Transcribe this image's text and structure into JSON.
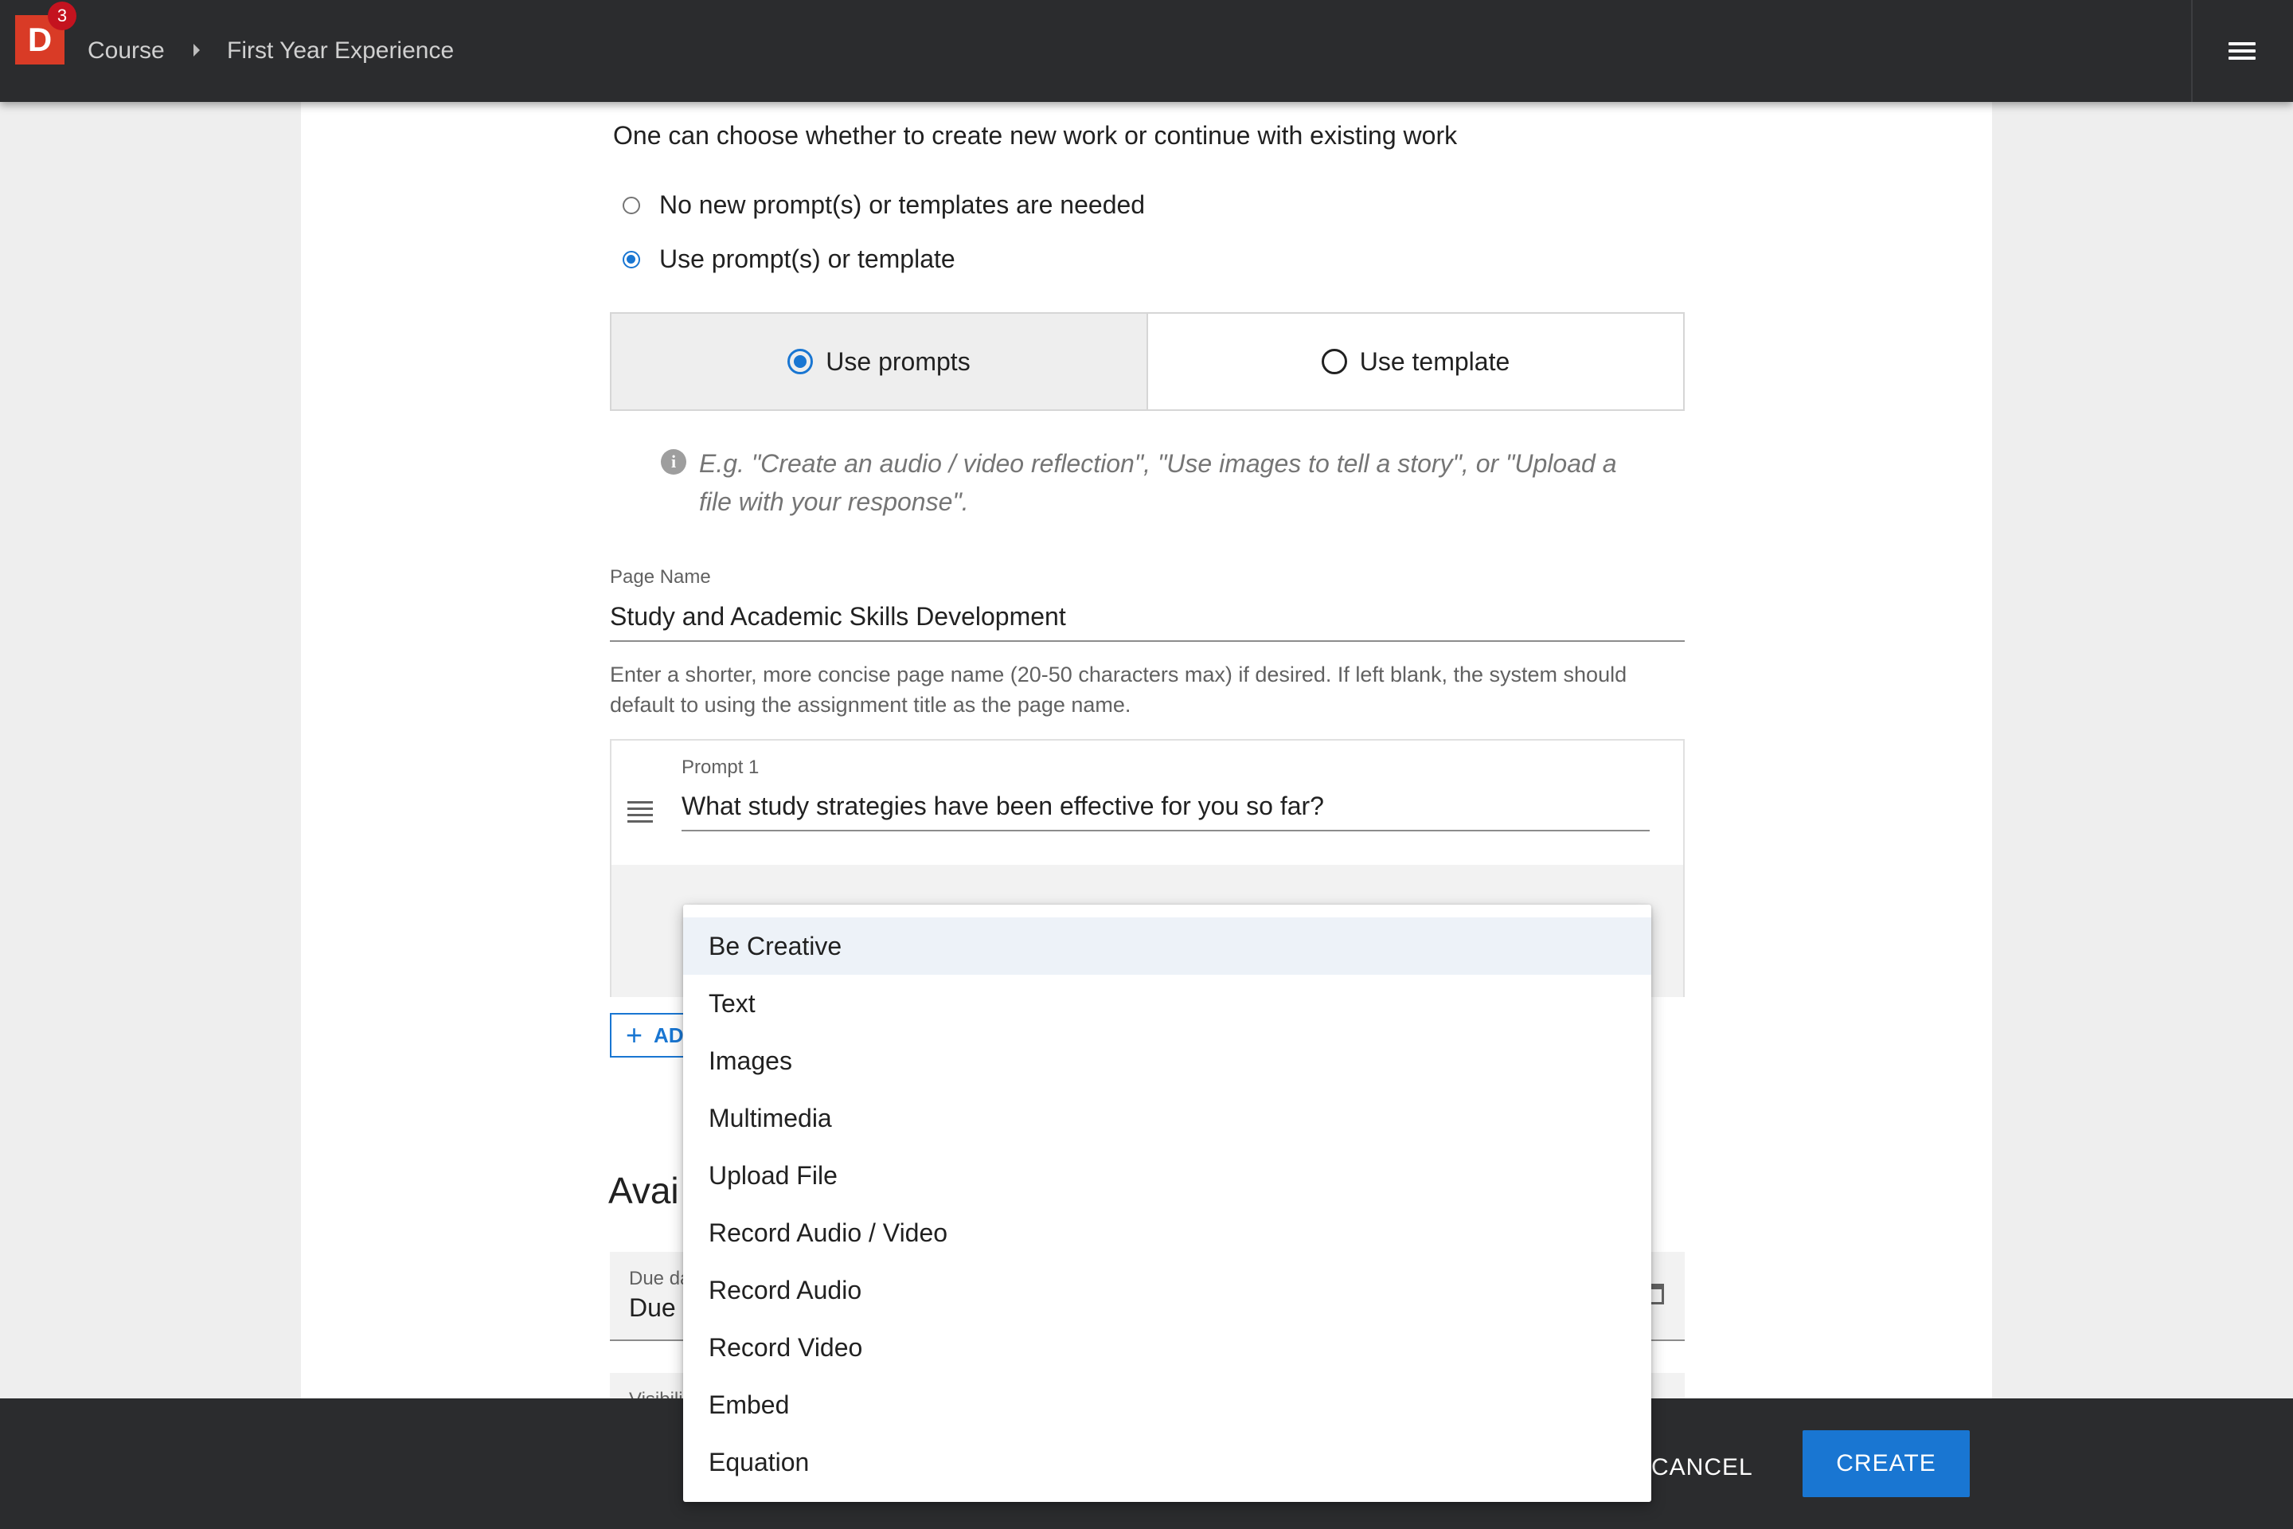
{
  "topbar": {
    "logo_letter": "D",
    "badge_count": "3",
    "breadcrumb": [
      "Course",
      "First Year Experience"
    ]
  },
  "form": {
    "intro": "One can choose whether to create new work or continue with existing work",
    "options": [
      {
        "label": "No new prompt(s) or templates are needed",
        "selected": false
      },
      {
        "label": "Use prompt(s) or template",
        "selected": true
      }
    ],
    "toggle": {
      "use_prompts": "Use prompts",
      "use_template": "Use template",
      "selected": "use_prompts"
    },
    "hint": "E.g. \"Create an audio / video reflection\", \"Use images to tell a story\", or \"Upload a file with your response\".",
    "page_name": {
      "label": "Page Name",
      "value": "Study and Academic Skills Development",
      "help": "Enter a shorter, more concise page name (20-50 characters max) if desired. If left blank, the system should default to using the assignment title as the page name."
    },
    "prompt1": {
      "label": "Prompt 1",
      "value": "What study strategies have been effective for you so far?"
    },
    "add_button_label": "AD",
    "section_title": "Avai",
    "due_date": {
      "label": "Due da",
      "value": "Due"
    },
    "visibility_label": "Visibili"
  },
  "dropdown": {
    "items": [
      "Be Creative",
      "Text",
      "Images",
      "Multimedia",
      "Upload File",
      "Record Audio / Video",
      "Record Audio",
      "Record Video",
      "Embed",
      "Equation"
    ],
    "highlighted": "Be Creative"
  },
  "footer": {
    "cancel": "CANCEL",
    "create": "CREATE"
  },
  "colors": {
    "accent": "#1976d2",
    "topbar": "#2b2c2e",
    "logo": "#d93b26",
    "badge": "#c4131f"
  }
}
